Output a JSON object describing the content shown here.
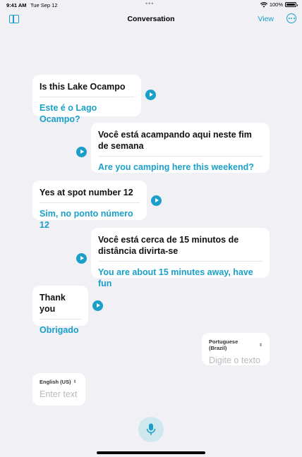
{
  "status_bar": {
    "time": "9:41 AM",
    "date": "Tue Sep 12",
    "battery": "100%"
  },
  "nav": {
    "title": "Conversation",
    "view_label": "View"
  },
  "messages": [
    {
      "source": "Is this Lake Ocampo",
      "translation": "Este é o Lago Ocampo?"
    },
    {
      "source": "Você está acampando aqui neste fim de semana",
      "translation": "Are you camping here this weekend?"
    },
    {
      "source": "Yes at spot number 12",
      "translation": "Sim, no ponto número 12"
    },
    {
      "source": "Você está cerca de 15 minutos de distância divirta-se",
      "translation": "You are about 15 minutes away, have fun"
    },
    {
      "source": "Thank you",
      "translation": "Obrigado"
    }
  ],
  "inputs": {
    "portuguese": {
      "language": "Portuguese (Brazil)",
      "placeholder": "Digite o texto"
    },
    "english": {
      "language": "English (US)",
      "placeholder": "Enter text"
    }
  },
  "colors": {
    "accent": "#1aa0c8",
    "background": "#f0f0f5"
  },
  "icons": [
    "sidebar-icon",
    "more-icon",
    "play-icon",
    "microphone-icon",
    "wifi-icon",
    "battery-icon"
  ]
}
